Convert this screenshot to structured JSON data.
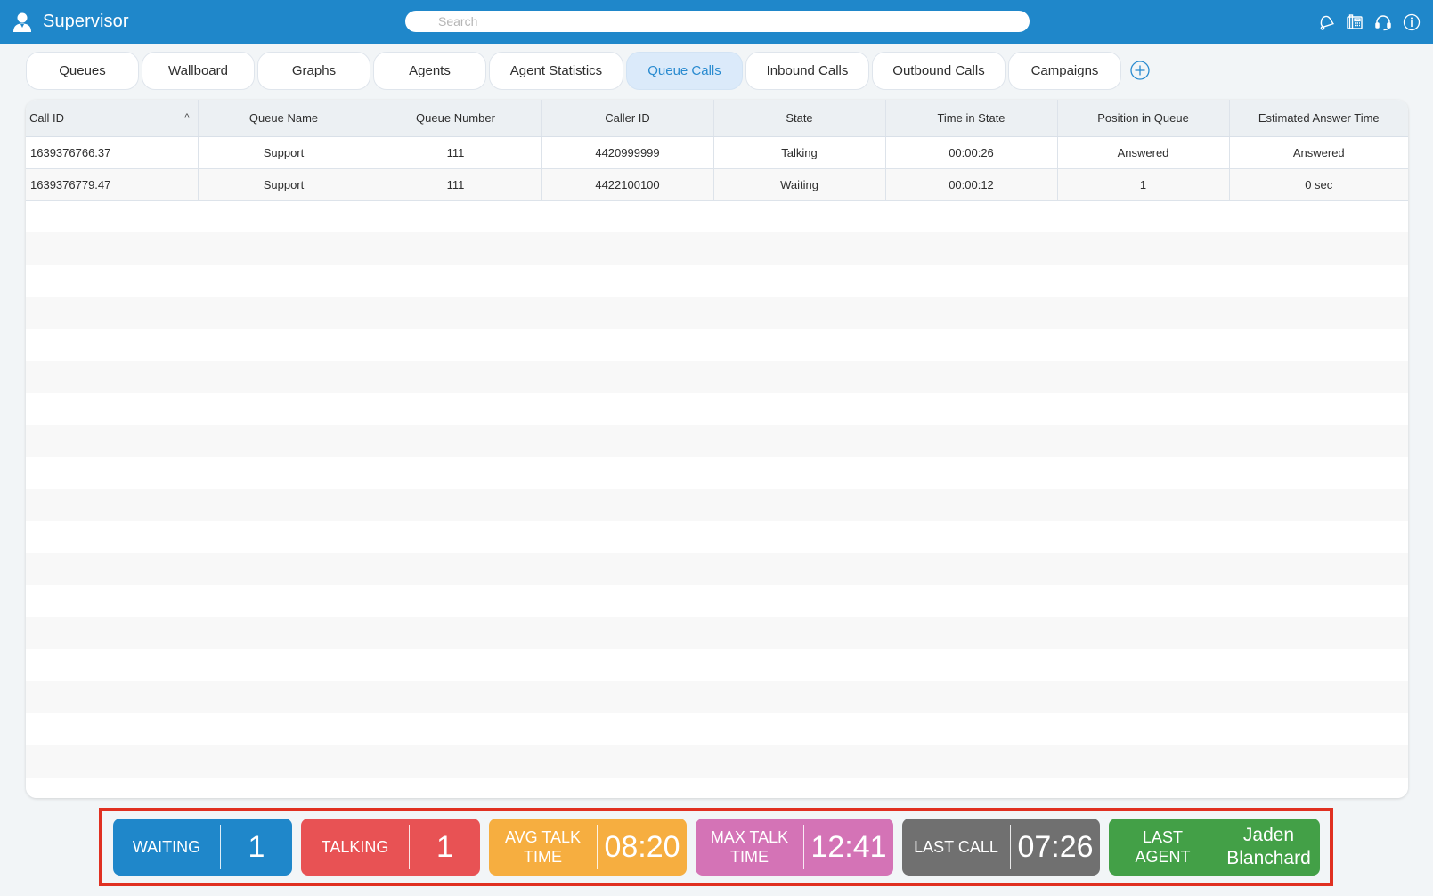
{
  "header": {
    "title": "Supervisor",
    "user_icon": "user-badge-icon",
    "search_placeholder": "Search",
    "search_value": "",
    "icons": [
      "bell-icon",
      "desk-phone-icon",
      "headset-icon",
      "info-icon"
    ]
  },
  "tabs": [
    {
      "label": "Queues",
      "active": false
    },
    {
      "label": "Wallboard",
      "active": false
    },
    {
      "label": "Graphs",
      "active": false
    },
    {
      "label": "Agents",
      "active": false
    },
    {
      "label": "Agent Statistics",
      "active": false
    },
    {
      "label": "Queue Calls",
      "active": true
    },
    {
      "label": "Inbound Calls",
      "active": false
    },
    {
      "label": "Outbound Calls",
      "active": false
    },
    {
      "label": "Campaigns",
      "active": false
    }
  ],
  "add_tab_icon": "plus-circle-icon",
  "table": {
    "sort_column": "Call ID",
    "sort_direction": "ascending",
    "columns": [
      "Call ID",
      "Queue Name",
      "Queue Number",
      "Caller ID",
      "State",
      "Time in State",
      "Position in Queue",
      "Estimated Answer Time"
    ],
    "rows": [
      [
        "1639376766.37",
        "Support",
        "111",
        "4420999999",
        "Talking",
        "00:00:26",
        "Answered",
        "Answered"
      ],
      [
        "1639376779.47",
        "Support",
        "111",
        "4422100100",
        "Waiting",
        "00:00:12",
        "1",
        "0 sec"
      ]
    ]
  },
  "stats": [
    {
      "label": "WAITING",
      "value": "1",
      "color": "#1f87ca"
    },
    {
      "label": "TALKING",
      "value": "1",
      "color": "#e85254"
    },
    {
      "label": "AVG TALK TIME",
      "value": "08:20",
      "color": "#f6ae40"
    },
    {
      "label": "MAX TALK TIME",
      "value": "12:41",
      "color": "#d473b6"
    },
    {
      "label": "LAST CALL",
      "value": "07:26",
      "color": "#707070"
    },
    {
      "label": "LAST AGENT",
      "value": "Jaden Blanchard",
      "color": "#43a047"
    }
  ],
  "highlight_color": "#e03021"
}
